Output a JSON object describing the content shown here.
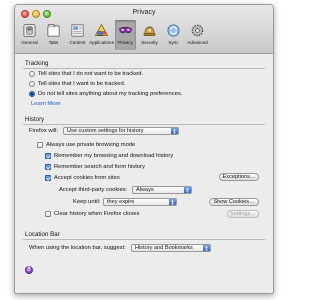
{
  "window": {
    "title": "Privacy"
  },
  "toolbar": [
    {
      "label": "General",
      "icon": "general-switch-icon"
    },
    {
      "label": "Tabs",
      "icon": "tabs-icon"
    },
    {
      "label": "Content",
      "icon": "content-icon"
    },
    {
      "label": "Applications",
      "icon": "applications-icon"
    },
    {
      "label": "Privacy",
      "icon": "privacy-mask-icon",
      "active": true
    },
    {
      "label": "Security",
      "icon": "security-icon"
    },
    {
      "label": "Sync",
      "icon": "sync-icon"
    },
    {
      "label": "Advanced",
      "icon": "advanced-gear-icon"
    }
  ],
  "tracking": {
    "title": "Tracking",
    "options": [
      "Tell sites that I do not want to be tracked.",
      "Tell sites that I want to be tracked.",
      "Do not tell sites anything about my tracking preferences."
    ],
    "selected_index": 2,
    "learn_more": "Learn More"
  },
  "history": {
    "title": "History",
    "firefox_will_label": "Firefox will:",
    "firefox_will_value": "Use custom settings for history",
    "private_mode": {
      "label": "Always use private browsing mode",
      "checked": false
    },
    "remember_browsing": {
      "label": "Remember my browsing and download history",
      "checked": true
    },
    "remember_search": {
      "label": "Remember search and form history",
      "checked": true
    },
    "accept_cookies": {
      "label": "Accept cookies from sites",
      "checked": true
    },
    "exceptions_button": "Exceptions…",
    "third_party_label": "Accept third-party cookies:",
    "third_party_value": "Always",
    "keep_until_label": "Keep until:",
    "keep_until_value": "they expire",
    "show_cookies_button": "Show Cookies…",
    "clear_on_close": {
      "label": "Clear history when Firefox closes",
      "checked": false
    },
    "settings_button": "Settings…"
  },
  "location_bar": {
    "title": "Location Bar",
    "suggest_label": "When using the location bar, suggest:",
    "suggest_value": "History and Bookmarks"
  },
  "help_button": "?",
  "colors": {
    "accent": "#3a74d4",
    "link": "#1a5bd6"
  }
}
